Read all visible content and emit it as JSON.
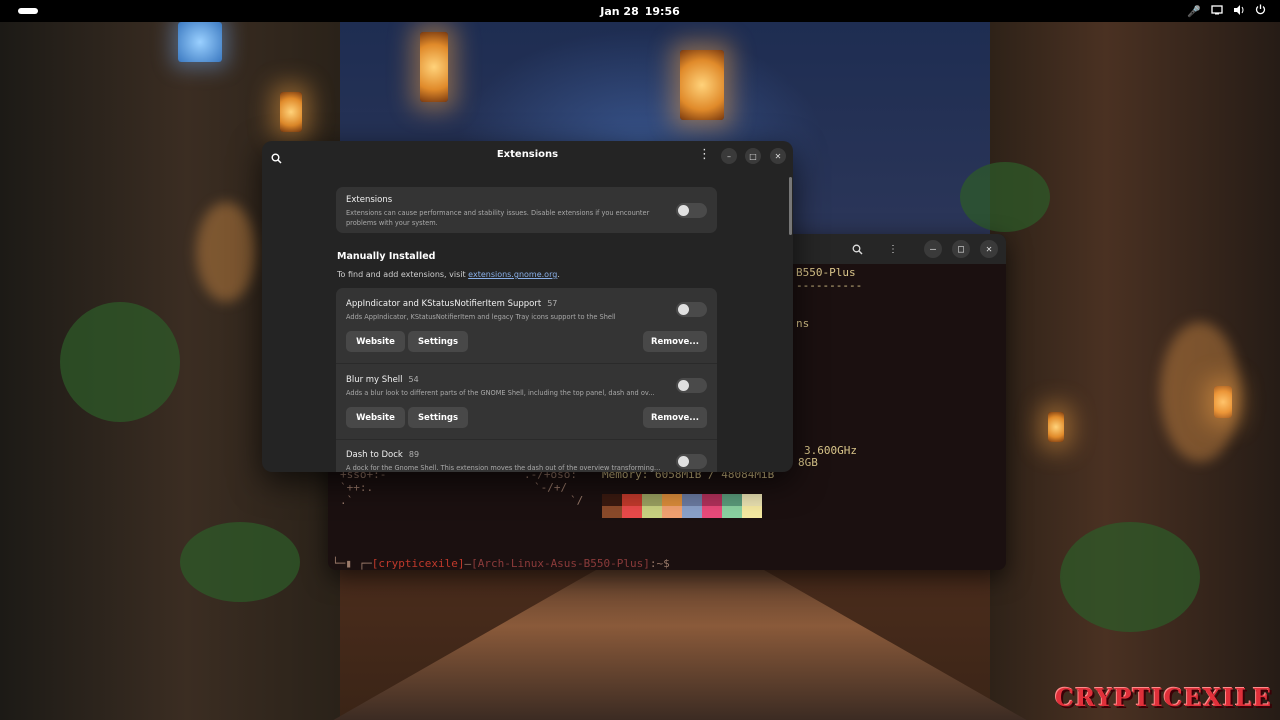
{
  "topbar": {
    "date": "Jan 28",
    "time": "19:56",
    "icons": [
      "microphone-icon",
      "screen-icon",
      "volume-icon",
      "power-icon"
    ]
  },
  "watermark": "CRYPTICEXILE",
  "extensions_window": {
    "title": "Extensions",
    "global": {
      "title": "Extensions",
      "description": "Extensions can cause performance and stability issues. Disable extensions if you encounter problems with your system.",
      "enabled": false
    },
    "section": {
      "title": "Manually Installed",
      "subtitle_prefix": "To find and add extensions, visit ",
      "link": "extensions.gnome.org",
      "subtitle_suffix": "."
    },
    "items": [
      {
        "name": "AppIndicator and KStatusNotifierItem Support",
        "version": "57",
        "description": "Adds AppIndicator, KStatusNotifierItem and legacy Tray icons support to the Shell",
        "enabled": false,
        "website_label": "Website",
        "settings_label": "Settings",
        "remove_label": "Remove..."
      },
      {
        "name": "Blur my Shell",
        "version": "54",
        "description": "Adds a blur look to different parts of the GNOME Shell, including the top panel, dash and ov...",
        "enabled": false,
        "website_label": "Website",
        "settings_label": "Settings",
        "remove_label": "Remove..."
      },
      {
        "name": "Dash to Dock",
        "version": "89",
        "description": "A dock for the Gnome Shell. This extension moves the dash out of the overview transforming...",
        "enabled": false
      }
    ]
  },
  "terminal": {
    "lines": {
      "host": "B550-Plus",
      "dashes": "----------",
      "ns": "ns",
      "cpu": "3.600GHz",
      "gpu": "8GB",
      "memory": "Memory: 6058MiB / 48084MiB",
      "art1": "+sso+:-",
      "art2": ".-/+oso:",
      "art3": "`++:.",
      "art4": "`-/+/",
      "art5": ".`",
      "art6": "`/",
      "prompt_user": "[crypticexile]",
      "prompt_sep": "—",
      "prompt_host": "[Arch-Linux-Asus-B550-Plus]",
      "prompt_tail": ":~$"
    },
    "palette_colors": [
      "#3a1a10",
      "#c0392b",
      "#9aa060",
      "#d98b3a",
      "#6a7aa0",
      "#b0305a",
      "#5a9a7a",
      "#e8e0b0",
      "#8a4a2a",
      "#e84a4a",
      "#c8d080",
      "#f0a070",
      "#8aa0c8",
      "#e84a7a",
      "#8ad0a0",
      "#f4e8a0"
    ]
  }
}
